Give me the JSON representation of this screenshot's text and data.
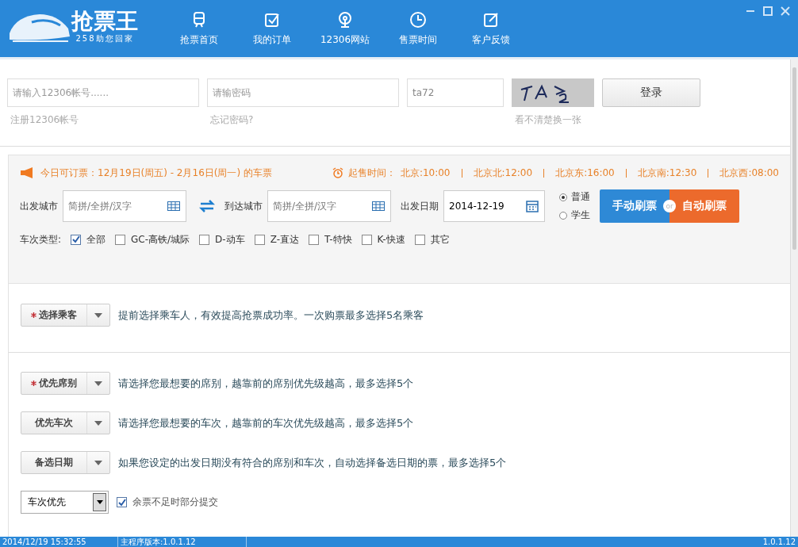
{
  "header": {
    "logo_title": "抢票王",
    "logo_subtitle": "258助您回家",
    "nav": [
      {
        "label": "抢票首页"
      },
      {
        "label": "我的订单"
      },
      {
        "label": "12306网站"
      },
      {
        "label": "售票时间"
      },
      {
        "label": "客户反馈"
      }
    ]
  },
  "login": {
    "account_placeholder": "请输入12306帐号......",
    "register_link": "注册12306帐号",
    "password_placeholder": "请输密码",
    "forgot_link": "忘记密码?",
    "captcha_value": "ta72",
    "captcha_hint": "看不清楚换一张",
    "login_button": "登录"
  },
  "notice": {
    "today": "今日可订票：12月19日(周五) - 2月16日(周一) 的车票",
    "sale_label": "起售时间：",
    "sale_times": [
      "北京:10:00",
      "北京北:12:00",
      "北京东:16:00",
      "北京南:12:30",
      "北京西:08:00"
    ]
  },
  "search": {
    "from_label": "出发城市",
    "from_placeholder": "简拼/全拼/汉字",
    "to_label": "到达城市",
    "to_placeholder": "简拼/全拼/汉字",
    "date_label": "出发日期",
    "date_value": "2014-12-19",
    "ticket_types": [
      {
        "label": "普通",
        "selected": true
      },
      {
        "label": "学生",
        "selected": false
      }
    ],
    "manual_button": "手动刷票",
    "or_badge": "or",
    "auto_button": "自动刷票"
  },
  "train_types": {
    "label": "车次类型:",
    "options": [
      {
        "label": "全部",
        "checked": true
      },
      {
        "label": "GC-高铁/城际",
        "checked": false
      },
      {
        "label": "D-动车",
        "checked": false
      },
      {
        "label": "Z-直达",
        "checked": false
      },
      {
        "label": "T-特快",
        "checked": false
      },
      {
        "label": "K-快速",
        "checked": false
      },
      {
        "label": "其它",
        "checked": false
      }
    ]
  },
  "passenger": {
    "label": "选择乘客",
    "required": true,
    "hint": "提前选择乘车人，有效提高抢票成功率。一次购票最多选择5名乘客"
  },
  "preferences": [
    {
      "label": "优先席别",
      "required": true,
      "hint": "请选择您最想要的席别，越靠前的席别优先级越高，最多选择5个"
    },
    {
      "label": "优先车次",
      "required": false,
      "hint": "请选择您最想要的车次，越靠前的车次优先级越高，最多选择5个"
    },
    {
      "label": "备选日期",
      "required": false,
      "hint": "如果您设定的出发日期没有符合的席别和车次，自动选择备选日期的票，最多选择5个"
    }
  ],
  "strategy": {
    "select_value": "车次优先",
    "partial_submit": {
      "label": "余票不足时部分提交",
      "checked": true
    }
  },
  "status_bar": [
    "2014/12/19 15:32:55",
    "主程序版本:1.0.1.12",
    "1.0.1.12"
  ]
}
